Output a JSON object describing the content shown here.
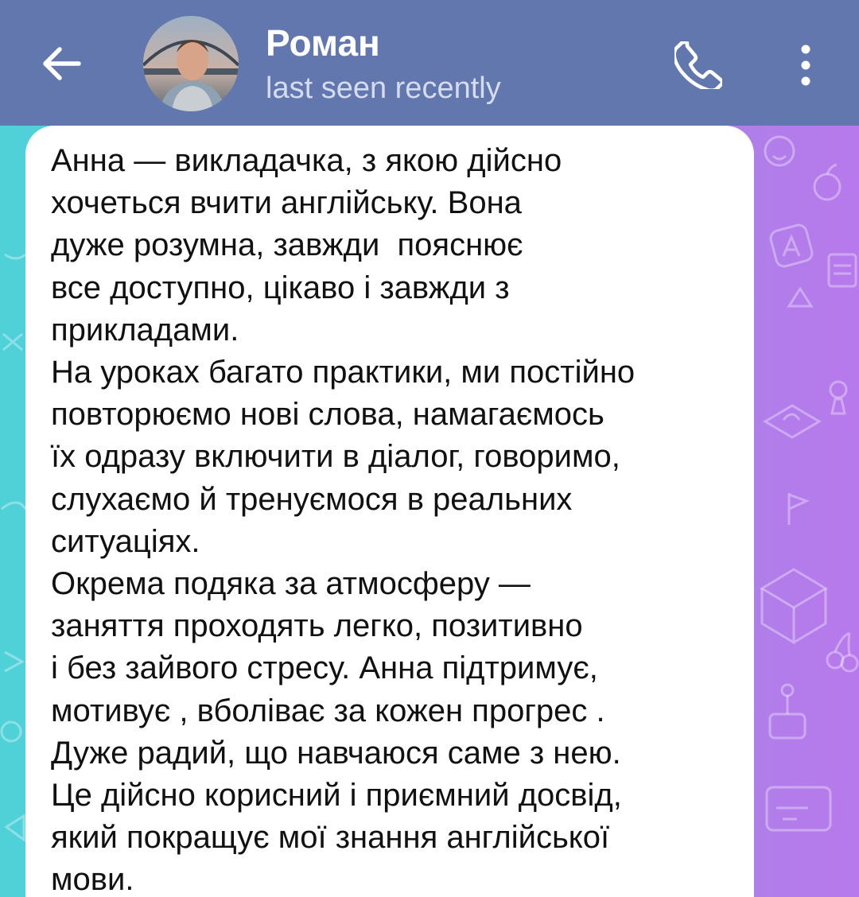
{
  "header": {
    "contact_name": "Роман",
    "status": "last seen recently",
    "back_icon": "arrow-left-icon",
    "call_icon": "phone-icon",
    "more_icon": "more-vertical-icon"
  },
  "colors": {
    "header_bg": "#6277ad",
    "bubble_bg": "#ffffff",
    "text": "#111111"
  },
  "message": {
    "lines": [
      "Анна — викладачка, з якою дійсно",
      "хочеться вчити англійську. Вона",
      "дуже розумна, завжди  пояснює",
      "все доступно, цікаво і завжди з",
      "прикладами.",
      "На уроках багато практики, ми постійно",
      "повторюємо нові слова, намагаємось",
      "їх одразу включити в діалог, говоримо,",
      "слухаємо й тренуємося в реальних",
      "ситуаціях.",
      "Окрема подяка за атмосферу —",
      "заняття проходять легко, позитивно",
      "і без зайвого стресу. Анна підтримує,",
      "мотивує , вболіває за кожен прогрес .",
      "Дуже радий, що навчаюся саме з нею.",
      "Це дійсно корисний і приємний досвід,",
      "який покращує мої знання англійської",
      "мови."
    ]
  }
}
